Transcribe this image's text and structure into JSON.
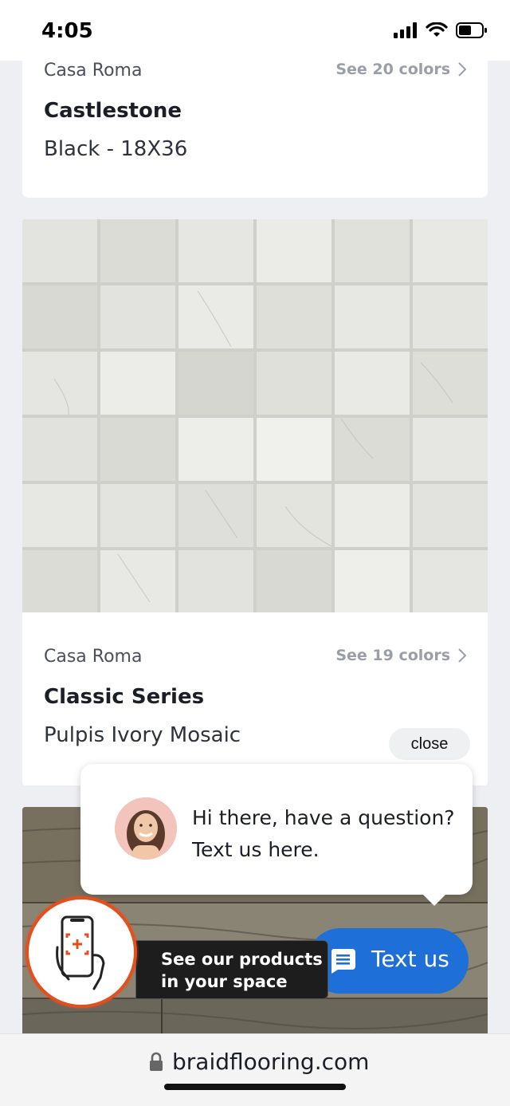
{
  "status_bar": {
    "time": "4:05"
  },
  "cards": [
    {
      "brand": "Casa Roma",
      "see_colors": "See 20 colors",
      "name": "Castlestone",
      "variant": "Black - 18X36"
    },
    {
      "brand": "Casa Roma",
      "see_colors": "See 19 colors",
      "name": "Classic Series",
      "variant": "Pulpis Ivory Mosaic"
    }
  ],
  "chat_widget": {
    "close_label": "close",
    "message": "Hi there, have a question? Text us here.",
    "button_label": "Text us",
    "accent": "#1f6fd8"
  },
  "ar_widget": {
    "label": "See our products in your space",
    "accent": "#e3501e"
  },
  "browser": {
    "url": "braidflooring.com"
  }
}
